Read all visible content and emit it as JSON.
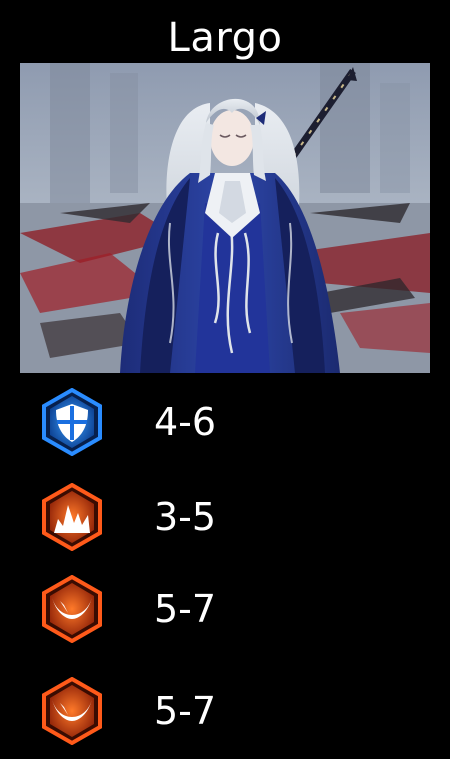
{
  "character": {
    "name": "Largo"
  },
  "stats": [
    {
      "icon": "shield-icon",
      "value": "4-6",
      "color": "#1e8cff"
    },
    {
      "icon": "flame-icon",
      "value": "3-5",
      "color": "#ff5a1a"
    },
    {
      "icon": "crescent-slash-icon",
      "value": "5-7",
      "color": "#ff5a1a"
    },
    {
      "icon": "crescent-slash-icon",
      "value": "5-7",
      "color": "#ff5a1a"
    }
  ]
}
